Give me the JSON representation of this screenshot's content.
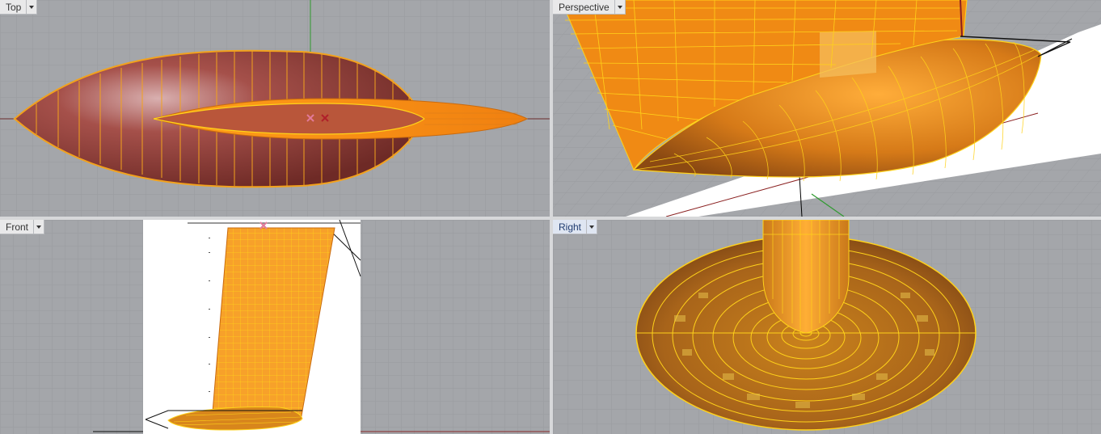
{
  "viewports": {
    "top": {
      "label": "Top"
    },
    "perspective": {
      "label": "Perspective"
    },
    "front": {
      "label": "Front"
    },
    "right": {
      "label": "Right"
    }
  },
  "colors": {
    "viewport_background": "#a4a6aa",
    "grid_line": "#9a9ca0",
    "grid_major": "#8d8f93",
    "surface_orange": "#f59a1e",
    "surface_dark": "#8a3b30",
    "isocurve_yellow": "#ffd21a",
    "x_axis": "#8a2c2c",
    "y_axis": "#2c8a2c"
  },
  "icons": {
    "viewport_menu": "chevron-down-icon",
    "object_center": "cross-marker-icon"
  }
}
